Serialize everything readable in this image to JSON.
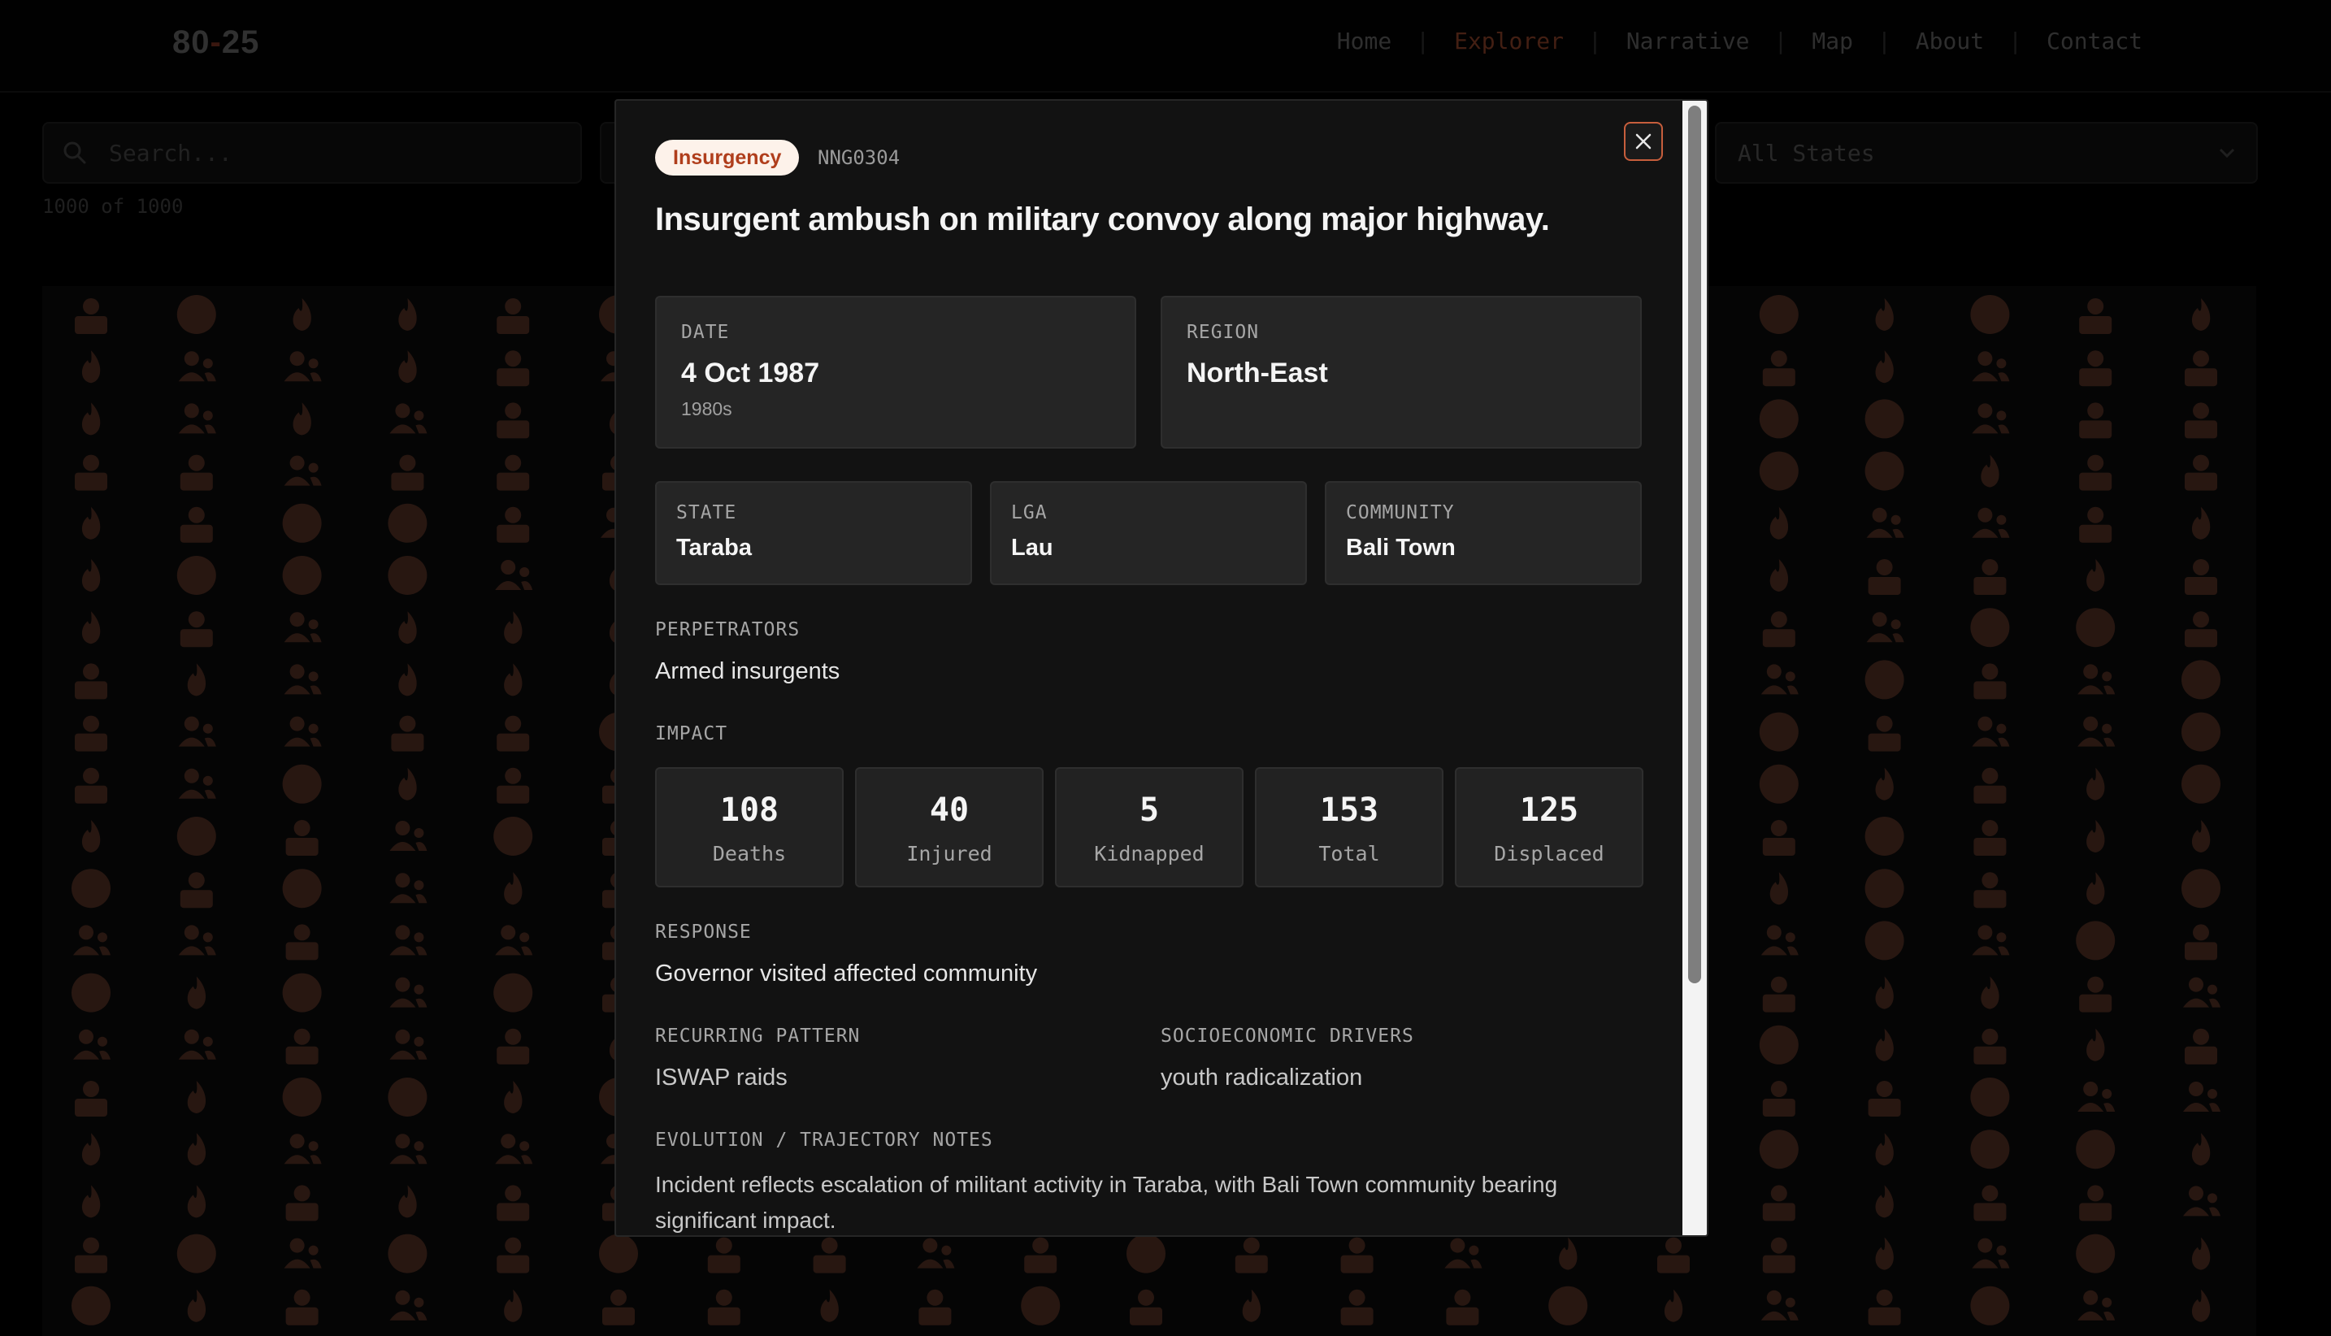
{
  "header": {
    "logo_left": "80",
    "logo_dash": "-",
    "logo_right": "25",
    "nav": [
      "Home",
      "Explorer",
      "Narrative",
      "Map",
      "About",
      "Contact"
    ],
    "nav_active": "Explorer",
    "separator": "|"
  },
  "toolbar": {
    "search_placeholder": "Search...",
    "state_select": "All States",
    "count": "1000 of 1000"
  },
  "colors": {
    "accent": "#c75e3c",
    "badge_bg": "#fdf2ea",
    "badge_text": "#b03e1c",
    "icon_dim": "#4a2a20"
  },
  "modal": {
    "badge": "Insurgency",
    "id": "NNG0304",
    "title": "Insurgent ambush on military convoy along major highway.",
    "date": {
      "label": "DATE",
      "value": "4 Oct 1987",
      "decade": "1980s"
    },
    "region": {
      "label": "REGION",
      "value": "North-East"
    },
    "state": {
      "label": "STATE",
      "value": "Taraba"
    },
    "lga": {
      "label": "LGA",
      "value": "Lau"
    },
    "community": {
      "label": "COMMUNITY",
      "value": "Bali Town"
    },
    "perpetrators": {
      "label": "PERPETRATORS",
      "value": "Armed insurgents"
    },
    "impact": {
      "label": "IMPACT",
      "stats": [
        {
          "value": "108",
          "caption": "Deaths"
        },
        {
          "value": "40",
          "caption": "Injured"
        },
        {
          "value": "5",
          "caption": "Kidnapped"
        },
        {
          "value": "153",
          "caption": "Total"
        },
        {
          "value": "125",
          "caption": "Displaced"
        }
      ]
    },
    "response": {
      "label": "RESPONSE",
      "value": "Governor visited affected community"
    },
    "recurring": {
      "label": "RECURRING PATTERN",
      "value": "ISWAP raids"
    },
    "drivers": {
      "label": "SOCIOECONOMIC DRIVERS",
      "value": "youth radicalization"
    },
    "notes": {
      "label": "EVOLUTION / TRAJECTORY NOTES",
      "value": "Incident reflects escalation of militant activity in Taraba, with Bali Town community bearing significant impact."
    }
  }
}
